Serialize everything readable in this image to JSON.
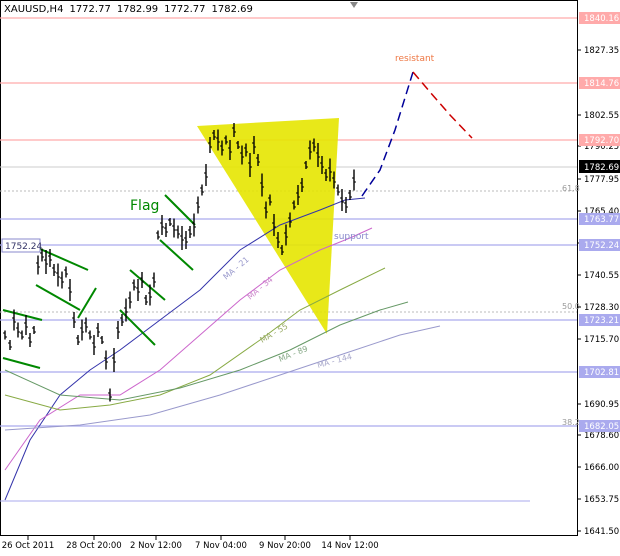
{
  "header": {
    "symbol": "XAUUSD,H4",
    "open": "1772.77",
    "high": "1782.99",
    "low": "1772.77",
    "close": "1782.69"
  },
  "price_axis": {
    "ticks": [
      "1827.35",
      "1802.55",
      "1790.25",
      "1777.95",
      "1765.40",
      "1752.85",
      "1740.55",
      "1728.30",
      "1715.70",
      "1690.95",
      "1678.60",
      "1666.00",
      "1653.75",
      "1641.50"
    ],
    "current_price": "1782.69",
    "level_labels": [
      "1840.16",
      "1814.76",
      "1792.70",
      "1763.77",
      "1752.24",
      "1723.21",
      "1702.81",
      "1682.05"
    ],
    "left_level_label": "1752.24"
  },
  "time_axis": {
    "labels": [
      "26 Oct 2011",
      "28 Oct 20:00",
      "2 Nov 12:00",
      "7 Nov 04:00",
      "9 Nov 20:00",
      "14 Nov 12:00"
    ]
  },
  "annotations": {
    "flag": "Flag",
    "support": "support",
    "resistant": "resistant",
    "fib_61": "61.8",
    "fib_50": "50.0",
    "fib_38": "38.2",
    "ma21": "MA - 21",
    "ma34": "MA - 34",
    "ma55": "MA - 55",
    "ma89": "MA - 89",
    "ma144": "MA - 144"
  },
  "colors": {
    "resistance_line": "#ffaaaa",
    "support_line": "#aaaaee",
    "triangle": "#e6e600",
    "forecast_up": "#000099",
    "forecast_down": "#cc0000",
    "flag": "#008800",
    "ma21": "#3333aa",
    "ma34": "#cc66cc",
    "ma55": "#88aa44",
    "ma89": "#669966",
    "ma144": "#9999cc"
  }
}
